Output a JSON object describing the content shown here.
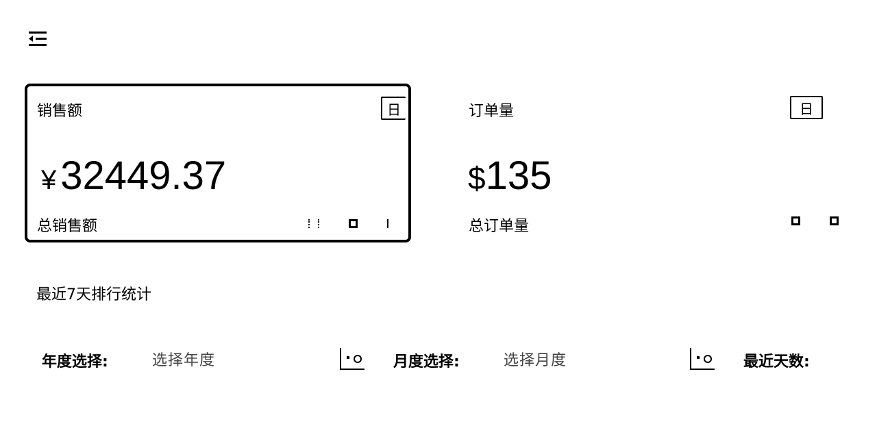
{
  "header": {
    "menu_icon": "menu-fold-icon"
  },
  "cards": {
    "sales": {
      "title": "销售额",
      "period": "日",
      "currency": "¥",
      "value": "32449.37",
      "footer": "总销售额"
    },
    "orders": {
      "title": "订单量",
      "period": "日",
      "currency": "$",
      "value": "135",
      "footer": "总订单量"
    }
  },
  "section": {
    "title": "最近7天排行统计"
  },
  "filters": {
    "year": {
      "label": "年度选择:",
      "placeholder": "选择年度"
    },
    "month": {
      "label": "月度选择:",
      "placeholder": "选择月度"
    },
    "days": {
      "label": "最近天数:"
    }
  },
  "colors": {
    "foreground": "#000000",
    "background": "#ffffff"
  }
}
